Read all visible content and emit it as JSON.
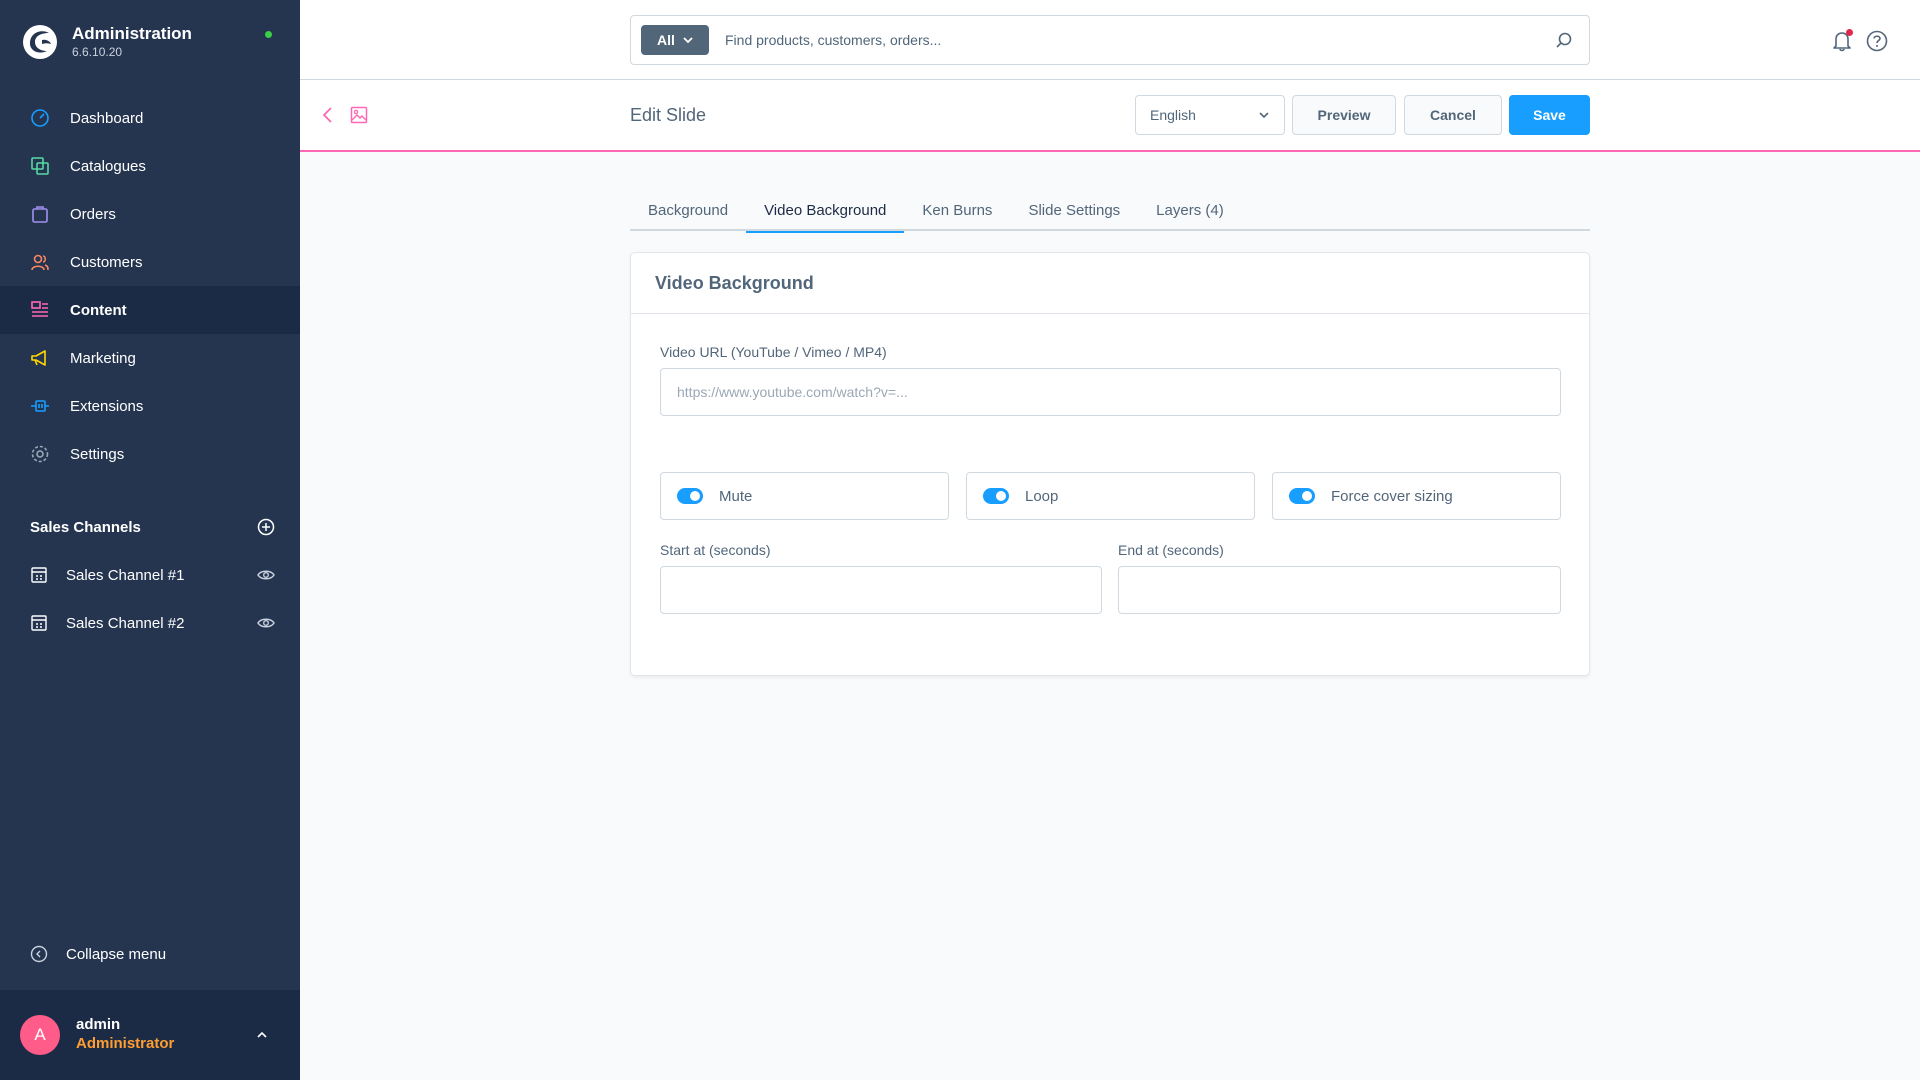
{
  "app": {
    "title": "Administration",
    "version": "6.6.10.20"
  },
  "sidebar": {
    "items": [
      {
        "label": "Dashboard",
        "icon": "dashboard-icon",
        "color": "#189eff"
      },
      {
        "label": "Catalogues",
        "icon": "catalogues-icon",
        "color": "#57d9a3"
      },
      {
        "label": "Orders",
        "icon": "orders-icon",
        "color": "#a092f0"
      },
      {
        "label": "Customers",
        "icon": "customers-icon",
        "color": "#f88962"
      },
      {
        "label": "Content",
        "icon": "content-icon",
        "color": "#ff68b4",
        "active": true
      },
      {
        "label": "Marketing",
        "icon": "marketing-icon",
        "color": "#ffd700"
      },
      {
        "label": "Extensions",
        "icon": "extensions-icon",
        "color": "#189eff"
      },
      {
        "label": "Settings",
        "icon": "settings-icon",
        "color": "#9aa8b5"
      }
    ],
    "sales_channels_title": "Sales Channels",
    "channels": [
      {
        "label": "Sales Channel #1"
      },
      {
        "label": "Sales Channel #2"
      }
    ],
    "collapse_label": "Collapse menu"
  },
  "user": {
    "initial": "A",
    "name": "admin",
    "role": "Administrator"
  },
  "search": {
    "type_label": "All",
    "placeholder": "Find products, customers, orders..."
  },
  "page": {
    "title": "Edit Slide",
    "language": "English",
    "preview_label": "Preview",
    "cancel_label": "Cancel",
    "save_label": "Save"
  },
  "tabs": [
    {
      "label": "Background"
    },
    {
      "label": "Video Background",
      "active": true
    },
    {
      "label": "Ken Burns"
    },
    {
      "label": "Slide Settings"
    },
    {
      "label": "Layers (4)"
    }
  ],
  "card": {
    "title": "Video Background",
    "video_url_label": "Video URL (YouTube / Vimeo / MP4)",
    "video_url_placeholder": "https://www.youtube.com/watch?v=...",
    "video_url_value": "",
    "toggles": [
      {
        "label": "Mute",
        "on": true
      },
      {
        "label": "Loop",
        "on": true
      },
      {
        "label": "Force cover sizing",
        "on": true
      }
    ],
    "start_label": "Start at (seconds)",
    "start_value": "",
    "end_label": "End at (seconds)",
    "end_value": ""
  },
  "colors": {
    "sidebar_bg": "#253550",
    "accent": "#189eff",
    "content_accent": "#ff68b4",
    "role_color": "#ff9e30",
    "status_online": "#37d046"
  }
}
